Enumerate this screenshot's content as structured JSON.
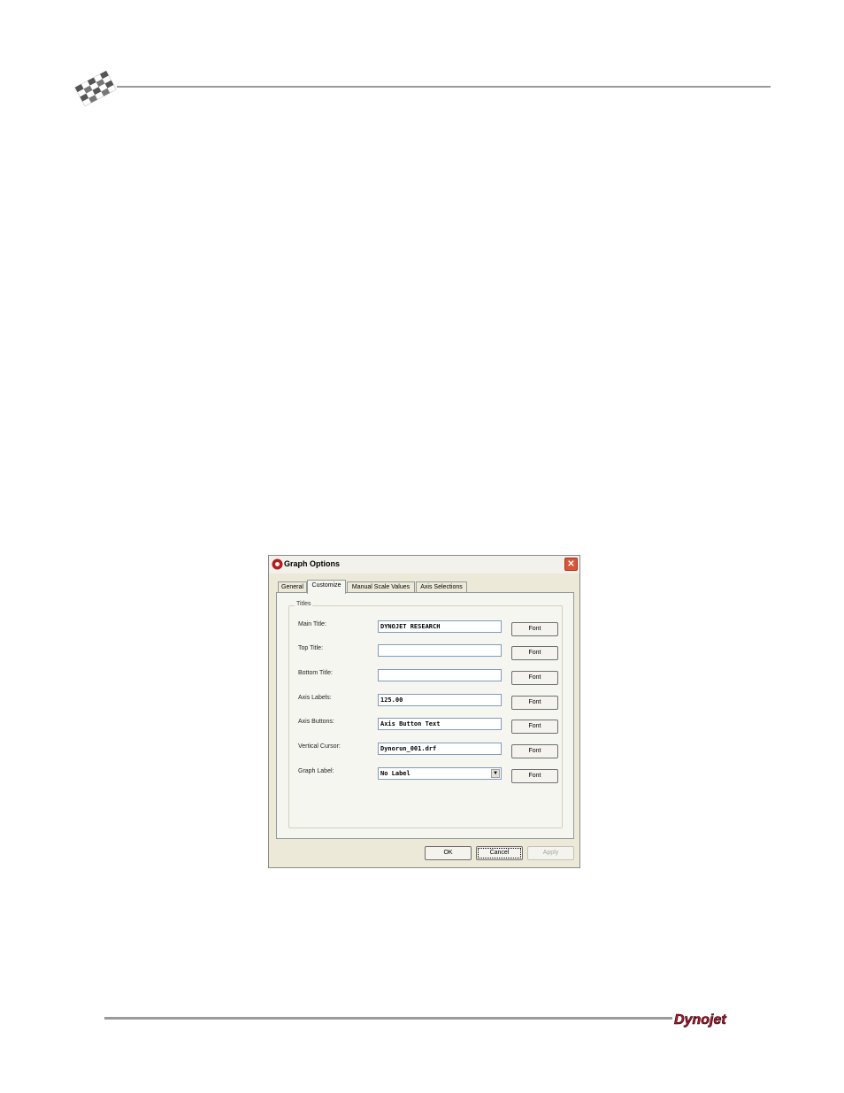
{
  "dialog": {
    "title": "Graph Options",
    "tabs": [
      {
        "label": "General"
      },
      {
        "label": "Customize"
      },
      {
        "label": "Manual Scale Values"
      },
      {
        "label": "Axis Selections"
      }
    ],
    "active_tab": "Customize",
    "group_label": "Titles",
    "rows": [
      {
        "label": "Main Title:",
        "value": "DYNOJET RESEARCH",
        "button": "Font"
      },
      {
        "label": "Top Title:",
        "value": "",
        "button": "Font"
      },
      {
        "label": "Bottom Title:",
        "value": "",
        "button": "Font"
      },
      {
        "label": "Axis Labels:",
        "value": "125.00",
        "button": "Font"
      },
      {
        "label": "Axis Buttons:",
        "value": "Axis Button Text",
        "button": "Font"
      },
      {
        "label": "Vertical Cursor:",
        "value": "Dynorun_001.drf",
        "button": "Font"
      },
      {
        "label": "Graph Label:",
        "value": "No Label",
        "button": "Font"
      }
    ],
    "buttons": {
      "ok": "OK",
      "cancel": "Cancel",
      "apply": "Apply"
    }
  },
  "footer": {
    "logo_text": "Dynojet"
  },
  "colors": {
    "title_bar": "#f2f1ec",
    "dialog_bg": "#ece9d8",
    "close_button": "#d9553a",
    "logo_red": "#c8102e"
  }
}
